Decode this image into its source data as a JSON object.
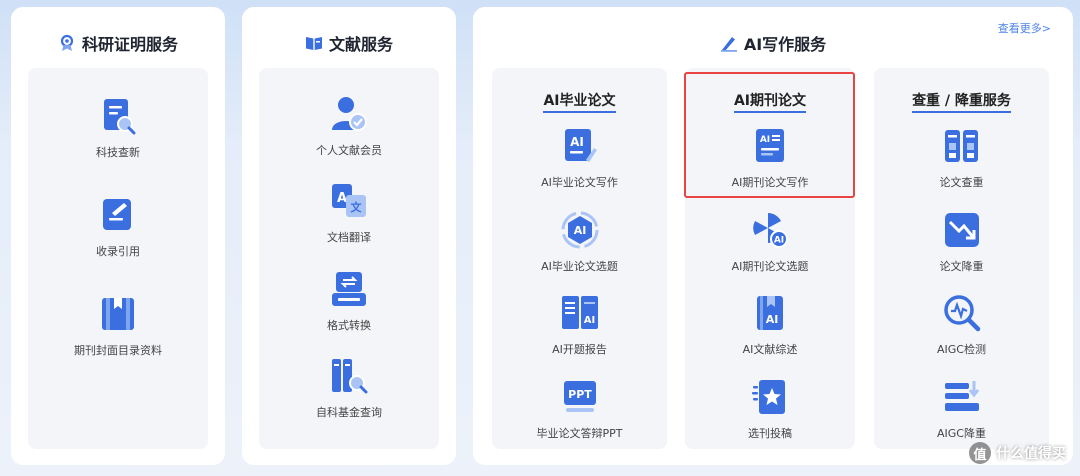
{
  "colors": {
    "accent": "#3b6fe0",
    "highlight": "#e94444",
    "link": "#4f84e8"
  },
  "research_panel": {
    "title": "科研证明服务",
    "icon": "award-ribbon-icon",
    "items": [
      {
        "label": "科技查新",
        "icon": "document-search-icon"
      },
      {
        "label": "收录引用",
        "icon": "document-edit-icon"
      },
      {
        "label": "期刊封面目录资料",
        "icon": "journal-book-icon"
      }
    ]
  },
  "literature_panel": {
    "title": "文献服务",
    "icon": "open-book-icon",
    "items": [
      {
        "label": "个人文献会员",
        "icon": "user-verified-icon"
      },
      {
        "label": "文档翻译",
        "icon": "translate-icon"
      },
      {
        "label": "格式转换",
        "icon": "format-convert-icon"
      },
      {
        "label": "自科基金查询",
        "icon": "fund-search-icon"
      }
    ]
  },
  "ai_panel": {
    "title": "AI写作服务",
    "icon": "ai-pen-icon",
    "more_link": "查看更多>",
    "columns": [
      {
        "title": "AI毕业论文",
        "items": [
          {
            "label": "AI毕业论文写作",
            "icon": "ai-document-icon"
          },
          {
            "label": "AI毕业论文选题",
            "icon": "ai-badge-icon"
          },
          {
            "label": "AI开题报告",
            "icon": "ai-open-book-icon"
          },
          {
            "label": "毕业论文答辩PPT",
            "icon": "ppt-icon"
          }
        ]
      },
      {
        "title": "AI期刊论文",
        "items": [
          {
            "label": "AI期刊论文写作",
            "icon": "ai-journal-icon"
          },
          {
            "label": "AI期刊论文选题",
            "icon": "ai-fan-icon"
          },
          {
            "label": "AI文献综述",
            "icon": "ai-bookmark-icon"
          },
          {
            "label": "选刊投稿",
            "icon": "submit-star-icon"
          }
        ]
      },
      {
        "title": "查重 / 降重服务",
        "items": [
          {
            "label": "论文查重",
            "icon": "calculator-icon"
          },
          {
            "label": "论文降重",
            "icon": "trend-down-icon"
          },
          {
            "label": "AIGC检测",
            "icon": "magnifier-wave-icon"
          },
          {
            "label": "AIGC降重",
            "icon": "layers-down-icon"
          }
        ]
      }
    ]
  },
  "watermark": {
    "badge": "值",
    "text": "什么值得买"
  }
}
